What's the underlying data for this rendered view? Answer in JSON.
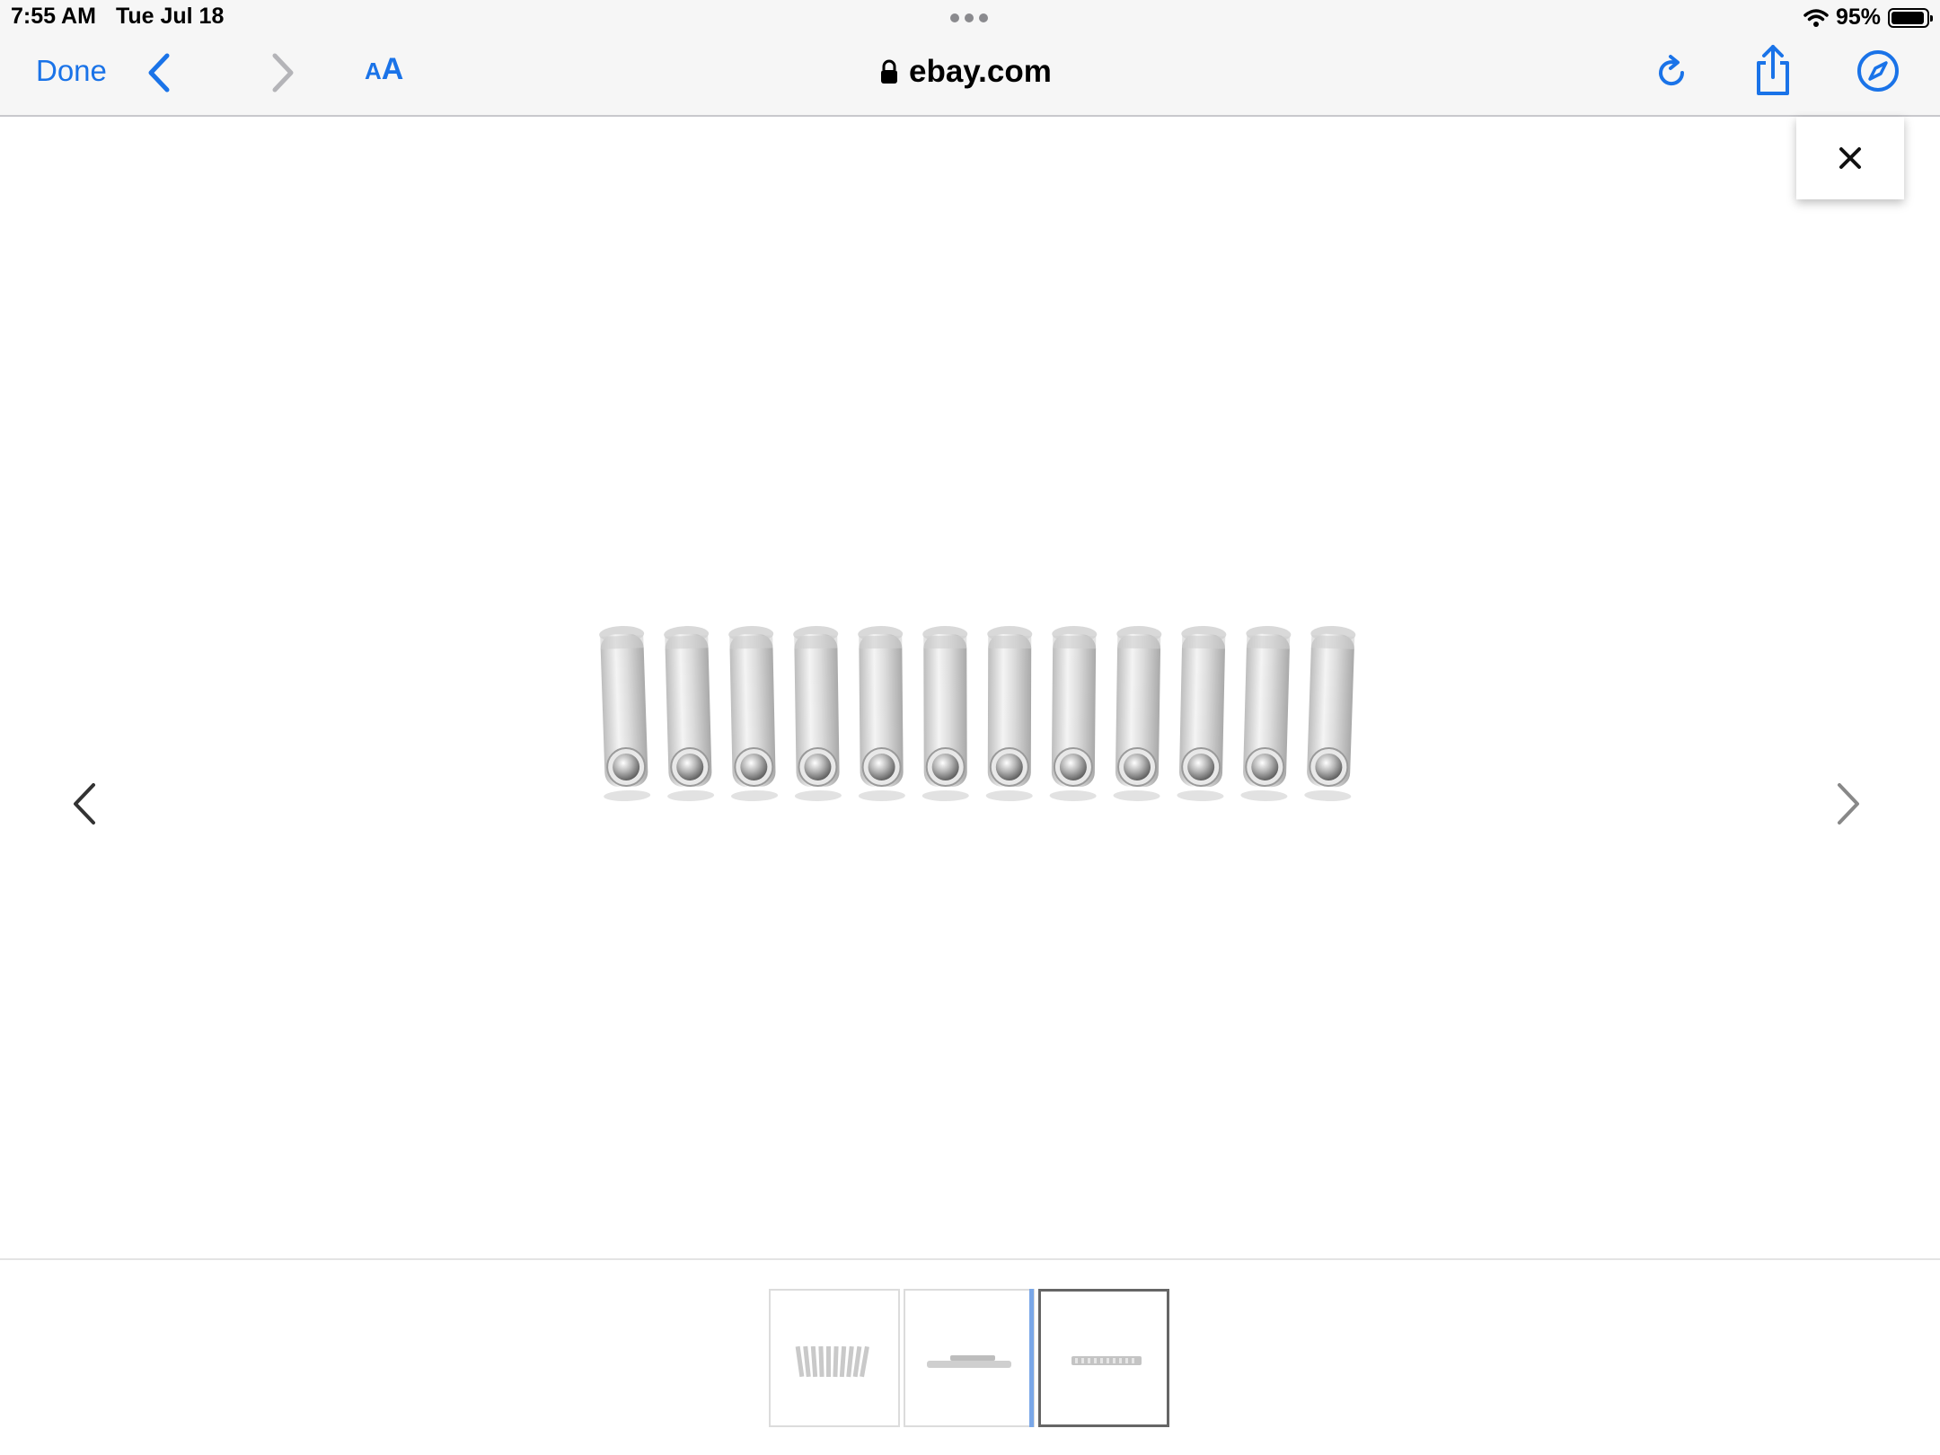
{
  "status_bar": {
    "time": "7:55 AM",
    "date": "Tue Jul 18",
    "battery_percent_label": "95%",
    "battery_level": 0.95
  },
  "toolbar": {
    "done_label": "Done",
    "text_size_small": "A",
    "text_size_big": "A",
    "address": "ebay.com"
  },
  "gallery": {
    "thumbnail_count": 3,
    "selected_index": 2
  },
  "icons": {
    "back": "chevron-left-icon",
    "forward": "chevron-right-icon",
    "lock": "lock-icon",
    "reload": "reload-icon",
    "share": "share-icon",
    "compass": "compass-icon",
    "close": "close-icon",
    "wifi": "wifi-icon",
    "battery": "battery-icon"
  },
  "colors": {
    "accent": "#1a73e8",
    "thumb_selected_border": "#666666",
    "thumb_marker": "#7aa7e8"
  }
}
